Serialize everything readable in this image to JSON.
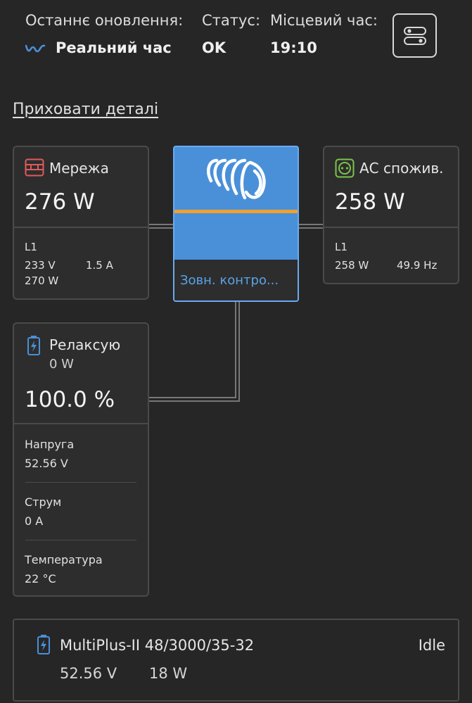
{
  "header": {
    "last_update_label": "Останнє оновлення:",
    "last_update_value": "Реальний час",
    "status_label": "Статус:",
    "status_value": "OK",
    "local_time_label": "Місцевий час:",
    "local_time_value": "19:10"
  },
  "toggle_details": "Приховати деталі",
  "grid": {
    "title": "Мережа",
    "power": "276 W",
    "phase": "L1",
    "voltage": "233 V",
    "current": "1.5 A",
    "phase_power": "270 W"
  },
  "inverter": {
    "label": "Зовн. контро..."
  },
  "ac_loads": {
    "title": "АС спожив.",
    "power": "258 W",
    "phase": "L1",
    "phase_power": "258 W",
    "frequency": "49.9 Hz"
  },
  "battery": {
    "state": "Релаксую",
    "power": "0 W",
    "soc": "100.0 %",
    "voltage_label": "Напруга",
    "voltage_value": "52.56 V",
    "current_label": "Струм",
    "current_value": "0 A",
    "temperature_label": "Температура",
    "temperature_value": "22 °C"
  },
  "device": {
    "name": "MultiPlus-II 48/3000/35-32",
    "state": "Idle",
    "voltage": "52.56 V",
    "power": "18 W"
  },
  "colors": {
    "background": "#262626",
    "inverter_blue": "#4a90d9",
    "accent_orange": "#f0a030",
    "grid_icon": "#e05a5a",
    "ac_icon": "#7cc44a",
    "battery_icon": "#4a90d9"
  }
}
